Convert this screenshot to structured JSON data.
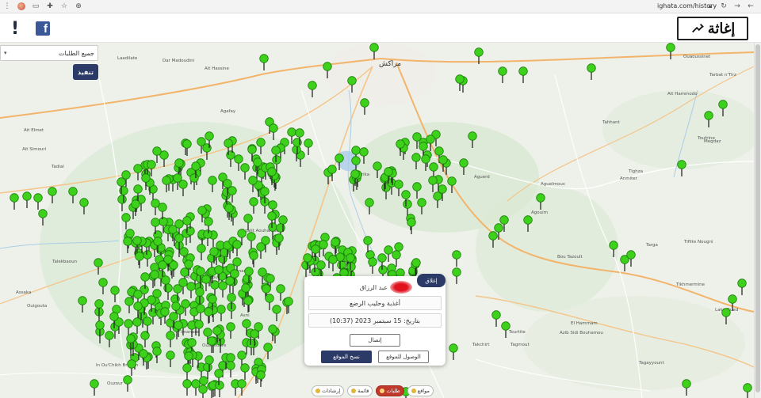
{
  "browser": {
    "url": "ighata.com/history",
    "icons": [
      "menu-dots-icon",
      "extension-avatar",
      "side-panel-icon",
      "puzzle-icon",
      "star-icon",
      "translate-icon",
      "reload-icon",
      "back-icon",
      "forward-icon",
      "lock-icon"
    ]
  },
  "header": {
    "alert_symbol": "!",
    "facebook_symbol": "f",
    "logo_text": "إغاثة"
  },
  "filter": {
    "selected": "جميع الطلبات",
    "apply_label": "تنفيذ"
  },
  "places": [
    {
      "name": "مراكش",
      "big": true
    },
    {
      "name": "Ouaoussinet"
    },
    {
      "name": "Tarbat n'Tirz"
    },
    {
      "name": "Tahhant"
    },
    {
      "name": "Toufrine"
    },
    {
      "name": "Megdaz"
    },
    {
      "name": "Ait Hammodo"
    },
    {
      "name": "Laadilate"
    },
    {
      "name": "Dar Madoudini"
    },
    {
      "name": "Ait Hassine"
    },
    {
      "name": "Ait Elmet"
    },
    {
      "name": "Ait Simouri"
    },
    {
      "name": "Tadial"
    },
    {
      "name": "Talekbaoun"
    },
    {
      "name": "Assaka"
    },
    {
      "name": "Ouigouta"
    },
    {
      "name": "Agafay"
    },
    {
      "name": "Ourika"
    },
    {
      "name": "Aguerd"
    },
    {
      "name": "Aguelmous"
    },
    {
      "name": "Tighza"
    },
    {
      "name": "Anmiter"
    },
    {
      "name": "Agouim"
    },
    {
      "name": "Bou Tazoult"
    },
    {
      "name": "Targa"
    },
    {
      "name": "Tiflite Nougni"
    },
    {
      "name": "Tikhmermine"
    },
    {
      "name": "Lake Oued"
    },
    {
      "name": "Tourtite"
    },
    {
      "name": "El Hammam"
    },
    {
      "name": "Azib Sidi Bouhamou"
    },
    {
      "name": "Takchirt"
    },
    {
      "name": "Tagmout"
    },
    {
      "name": "Tagayyount"
    },
    {
      "name": "Asni"
    },
    {
      "name": "Amizmiz"
    },
    {
      "name": "Sidi Dahmane"
    },
    {
      "name": "Imanare"
    },
    {
      "name": "Ouadouare"
    },
    {
      "name": "Azrou Mellene"
    },
    {
      "name": "Agalit Aouhamou"
    },
    {
      "name": "Ouzour"
    },
    {
      "name": "In Ou'Chikh Brahim"
    }
  ],
  "popup": {
    "close_label": "إغلاق",
    "name": "عبد الرزاق",
    "need": "أغذية وحليب الرضع",
    "date": "بتاريخ: 15 سبتمبر 2023 (10:37)",
    "contact_label": "إتصال",
    "goto_label": "الوصول للموقع",
    "copy_label": "نسخ الموقع"
  },
  "bottom_bar": [
    {
      "label": "مواقع",
      "active": false
    },
    {
      "label": "طلبات",
      "active": true
    },
    {
      "label": "قائمة",
      "active": false
    },
    {
      "label": "إرشادات",
      "active": false
    }
  ],
  "colors": {
    "pin_fill": "#3ed11c",
    "pin_stroke": "#1a7a0a",
    "brand_dark": "#2b3a67",
    "active_tab": "#c0392b"
  }
}
